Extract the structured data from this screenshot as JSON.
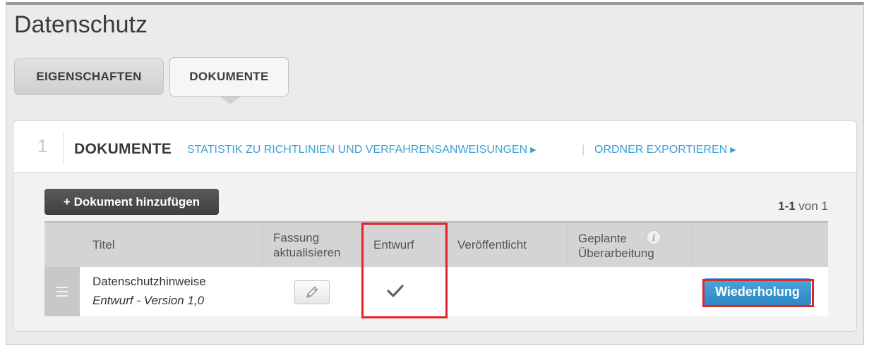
{
  "page": {
    "title": "Datenschutz"
  },
  "tabs": [
    {
      "label": "EIGENSCHAFTEN"
    },
    {
      "label": "DOKUMENTE"
    }
  ],
  "section": {
    "number": "1",
    "title": "DOKUMENTE",
    "links": [
      {
        "label": "STATISTIK ZU RICHTLINIEN UND VERFAHRENSANWEISUNGEN",
        "arrow": "▶"
      },
      {
        "label": "ORDNER EXPORTIEREN",
        "arrow": "▶"
      }
    ],
    "separator": "|"
  },
  "toolbar": {
    "add_label": "+ Dokument hinzufügen",
    "pager_range": "1-1",
    "pager_rest": " von 1"
  },
  "table": {
    "columns": [
      {
        "line1": "Titel"
      },
      {
        "line1": "Fassung",
        "line2": "aktualisieren"
      },
      {
        "line1": "Entwurf"
      },
      {
        "line1": "Veröffentlicht"
      },
      {
        "line1": "Geplante",
        "line2": "Überarbeitung",
        "icon": "info-icon"
      }
    ],
    "rows": [
      {
        "title": "Datenschutzhinweise",
        "subtitle": "Entwurf - Version 1,0",
        "update_icon": "pencil-icon",
        "draft_icon": "checkmark-icon",
        "action_label": "Wiederholung"
      }
    ]
  },
  "colors": {
    "link": "#3aa0d8",
    "action_button": "#2d88c2",
    "highlight": "#e3242b",
    "dark_button": "#444444"
  }
}
